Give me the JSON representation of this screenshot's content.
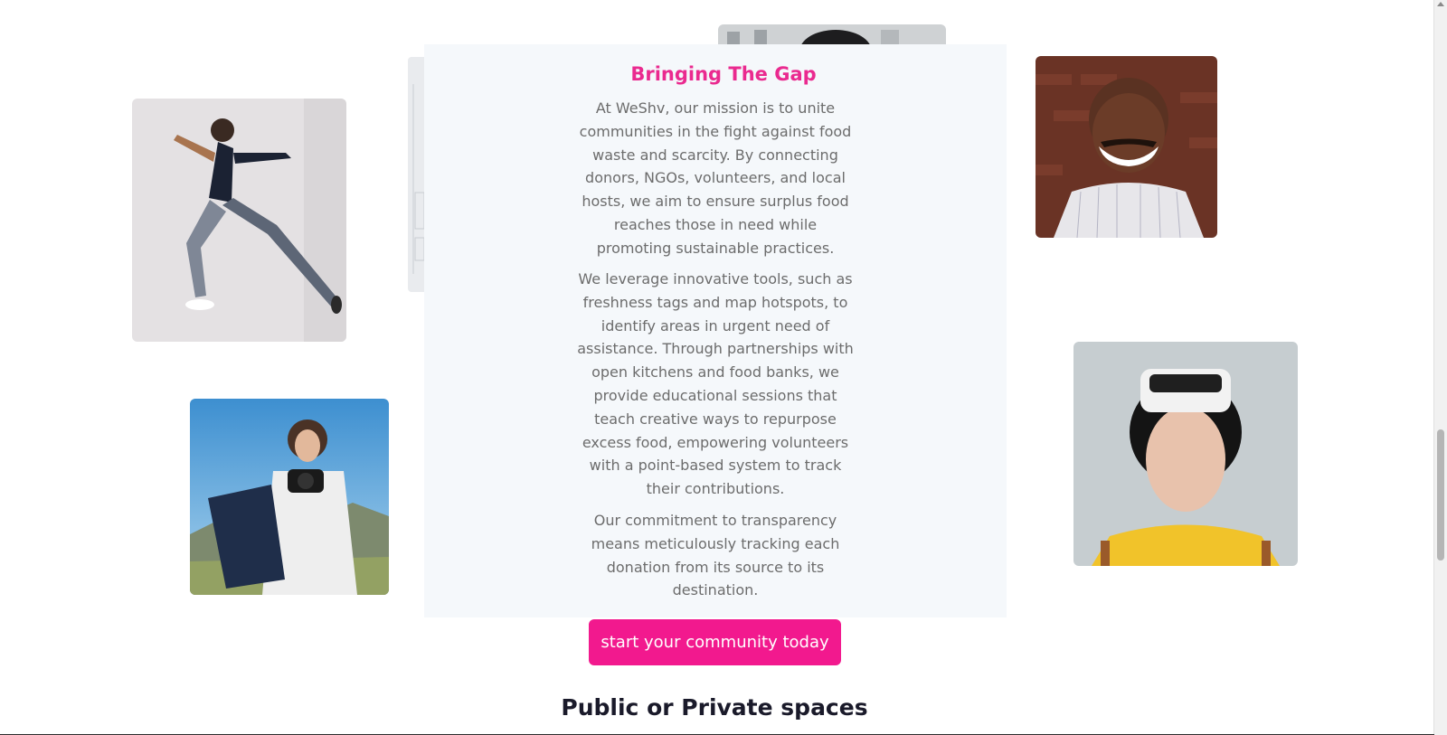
{
  "mission": {
    "title": "Bringing The Gap",
    "paragraphs": [
      "At WeShv, our mission is to unite communities in the fight against food waste and scarcity. By connecting donors, NGOs, volunteers, and local hosts, we aim to ensure surplus food reaches those in need while promoting sustainable practices.",
      "We leverage innovative tools, such as freshness tags and map hotspots, to identify areas in urgent need of assistance. Through partnerships with open kitchens and food banks, we provide educational sessions that teach creative ways to repurpose excess food, empowering volunteers with a point-based system to track their contributions.",
      "Our commitment to transparency means meticulously tracking each donation from its source to its destination."
    ]
  },
  "cta": {
    "label": "start your community today"
  },
  "next_section": {
    "heading": "Public or Private spaces"
  },
  "colors": {
    "accent": "#ea2a8f",
    "button": "#f2198e",
    "card_background": "#f5f8fb",
    "body_text": "#6c6c6c"
  }
}
